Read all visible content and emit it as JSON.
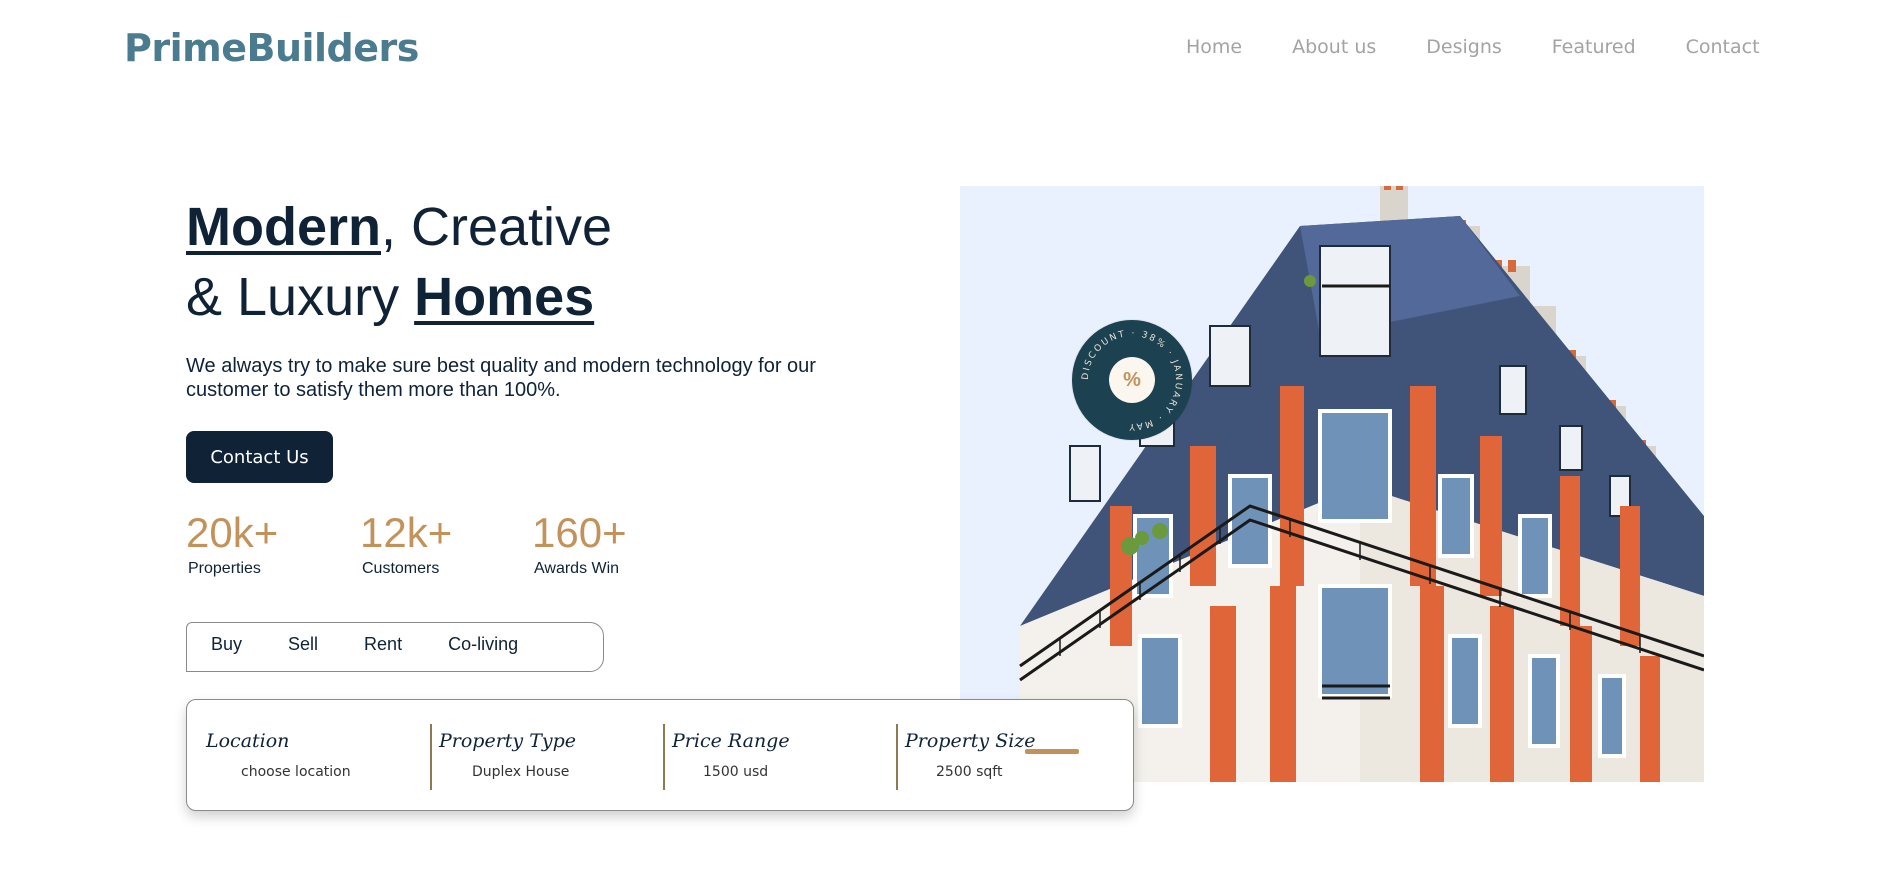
{
  "brand": {
    "name": "PrimeBuilders",
    "color": "#4b7b8f"
  },
  "nav": {
    "items": [
      "Home",
      "About us",
      "Designs",
      "Featured",
      "Contact"
    ]
  },
  "hero": {
    "headline_line1_bold": "Modern",
    "headline_line1_rest": ", Creative",
    "headline_line2_start": "& Luxury ",
    "headline_line2_bold": "Homes",
    "subtext": "We always try to make sure best quality and modern technology for our customer to satisfy them more than 100%.",
    "cta_label": "Contact Us"
  },
  "stats": [
    {
      "value": "20k+",
      "label": "Properties"
    },
    {
      "value": "12k+",
      "label": "Customers"
    },
    {
      "value": "160+",
      "label": "Awards Win"
    }
  ],
  "tabs": [
    "Buy",
    "Sell",
    "Rent",
    "Co-living"
  ],
  "search": {
    "fields": [
      {
        "label": "Location",
        "value": "choose location"
      },
      {
        "label": "Property Type",
        "value": "Duplex House"
      },
      {
        "label": "Price Range",
        "value": "1500 usd"
      },
      {
        "label": "Property Size",
        "value": "2500 sqft"
      }
    ]
  },
  "badge": {
    "ring_text": "DISCOUNT · 38% · JANUARY · MAY",
    "icon": "percent-badge-icon"
  },
  "colors": {
    "dark": "#0f2236",
    "accent": "#c3925a",
    "teal": "#1c4150"
  }
}
